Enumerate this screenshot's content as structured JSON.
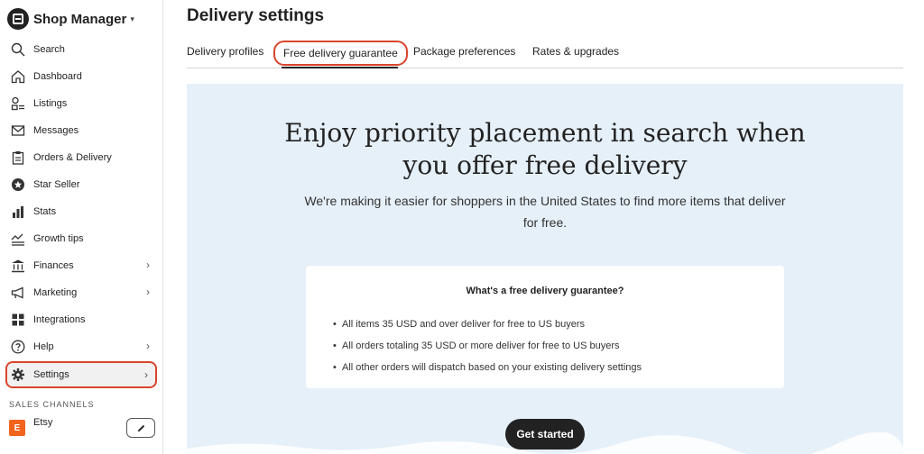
{
  "app": {
    "title": "Shop Manager",
    "caret": "▾"
  },
  "sidebar": {
    "items": [
      {
        "label": "Search",
        "icon": "search-icon"
      },
      {
        "label": "Dashboard",
        "icon": "home-icon"
      },
      {
        "label": "Listings",
        "icon": "listings-icon"
      },
      {
        "label": "Messages",
        "icon": "mail-icon"
      },
      {
        "label": "Orders & Delivery",
        "icon": "clipboard-icon"
      },
      {
        "label": "Star Seller",
        "icon": "star-badge-icon"
      },
      {
        "label": "Stats",
        "icon": "bar-chart-icon"
      },
      {
        "label": "Growth tips",
        "icon": "trend-icon"
      },
      {
        "label": "Finances",
        "icon": "bank-icon",
        "chevron": "›"
      },
      {
        "label": "Marketing",
        "icon": "megaphone-icon",
        "chevron": "›"
      },
      {
        "label": "Integrations",
        "icon": "grid-icon"
      },
      {
        "label": "Help",
        "icon": "help-icon",
        "chevron": "›"
      },
      {
        "label": "Settings",
        "icon": "gear-icon",
        "chevron": "›",
        "active": true
      }
    ],
    "sales_channels_title": "SALES CHANNELS",
    "channel": {
      "badge": "E",
      "label": "Etsy",
      "edit_icon": "pencil-icon"
    }
  },
  "main": {
    "title": "Delivery settings",
    "tabs": [
      {
        "label": "Delivery profiles"
      },
      {
        "label": "Free delivery guarantee",
        "active": true
      },
      {
        "label": "Package preferences"
      },
      {
        "label": "Rates & upgrades"
      }
    ],
    "hero": {
      "title_line1": "Enjoy priority placement in search when",
      "title_line2": "you offer free delivery",
      "subtitle": "We're making it easier for shoppers in the United States to find more items that deliver for free.",
      "card": {
        "title": "What's a free delivery guarantee?",
        "bullets": [
          "All items 35 USD and over deliver for free to US buyers",
          "All orders totaling 35 USD or more deliver for free to US buyers",
          "All other orders will dispatch based on your existing delivery settings"
        ]
      },
      "cta_label": "Get started"
    }
  },
  "colors": {
    "accent_outline": "#d9452c",
    "hero_bg": "#e6f0f9",
    "cta_bg": "#222222",
    "etsy_orange": "#f1641e"
  }
}
